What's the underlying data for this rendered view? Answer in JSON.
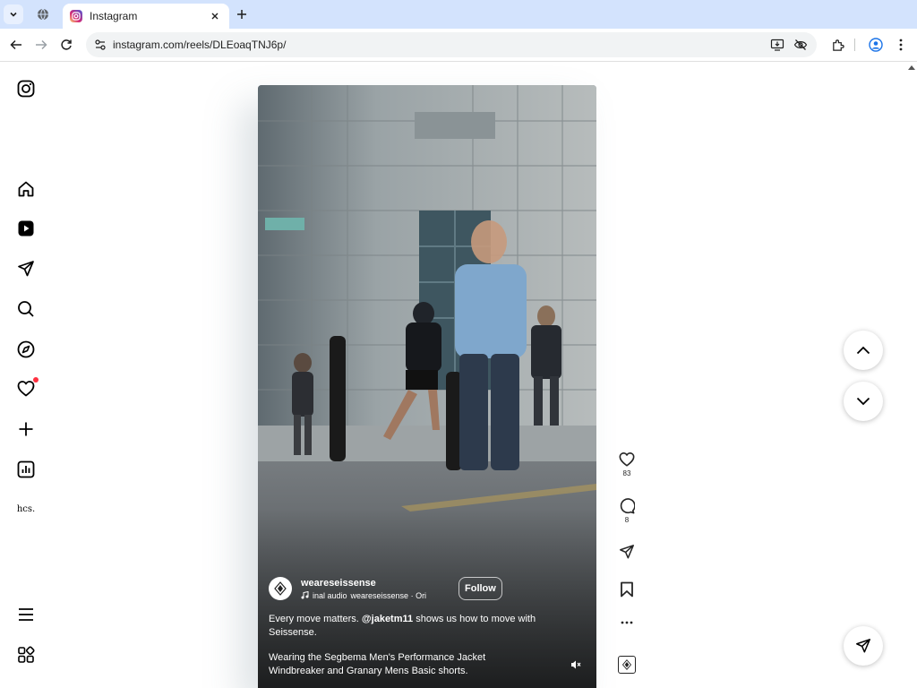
{
  "browser": {
    "tab_title": "Instagram",
    "url": "instagram.com/reels/DLEoaqTNJ6p/"
  },
  "sidebar": {
    "items": [
      {
        "name": "instagram-logo",
        "icon": "instagram-icon"
      },
      {
        "name": "home",
        "icon": "home-icon"
      },
      {
        "name": "reels",
        "icon": "reels-icon"
      },
      {
        "name": "messages",
        "icon": "direct-icon"
      },
      {
        "name": "search",
        "icon": "search-icon"
      },
      {
        "name": "explore",
        "icon": "compass-icon"
      },
      {
        "name": "notifications",
        "icon": "heart-icon"
      },
      {
        "name": "create",
        "icon": "plus-icon"
      },
      {
        "name": "dashboard",
        "icon": "insights-icon"
      },
      {
        "name": "profile",
        "icon": "profile-avatar"
      },
      {
        "name": "more",
        "icon": "menu-icon"
      },
      {
        "name": "also-from-meta",
        "icon": "apps-icon"
      }
    ],
    "profile_label": "hcs."
  },
  "reel": {
    "username": "weareseissense",
    "audio_prefix": "inal audio",
    "audio_owner": "weareseissense · Ori",
    "follow_label": "Follow",
    "caption_before": "Every move matters. ",
    "caption_mention": "@jaketm11",
    "caption_after": " shows us how to move with Seissense.",
    "caption_second": "Wearing the Segbema Men's Performance Jacket Windbreaker and Granary Mens Basic shorts."
  },
  "actions": {
    "likes": "83",
    "comments": "8"
  },
  "colors": {
    "tab_strip": "#d3e3fd",
    "notification_dot": "#ff3040",
    "text": "#262626"
  }
}
